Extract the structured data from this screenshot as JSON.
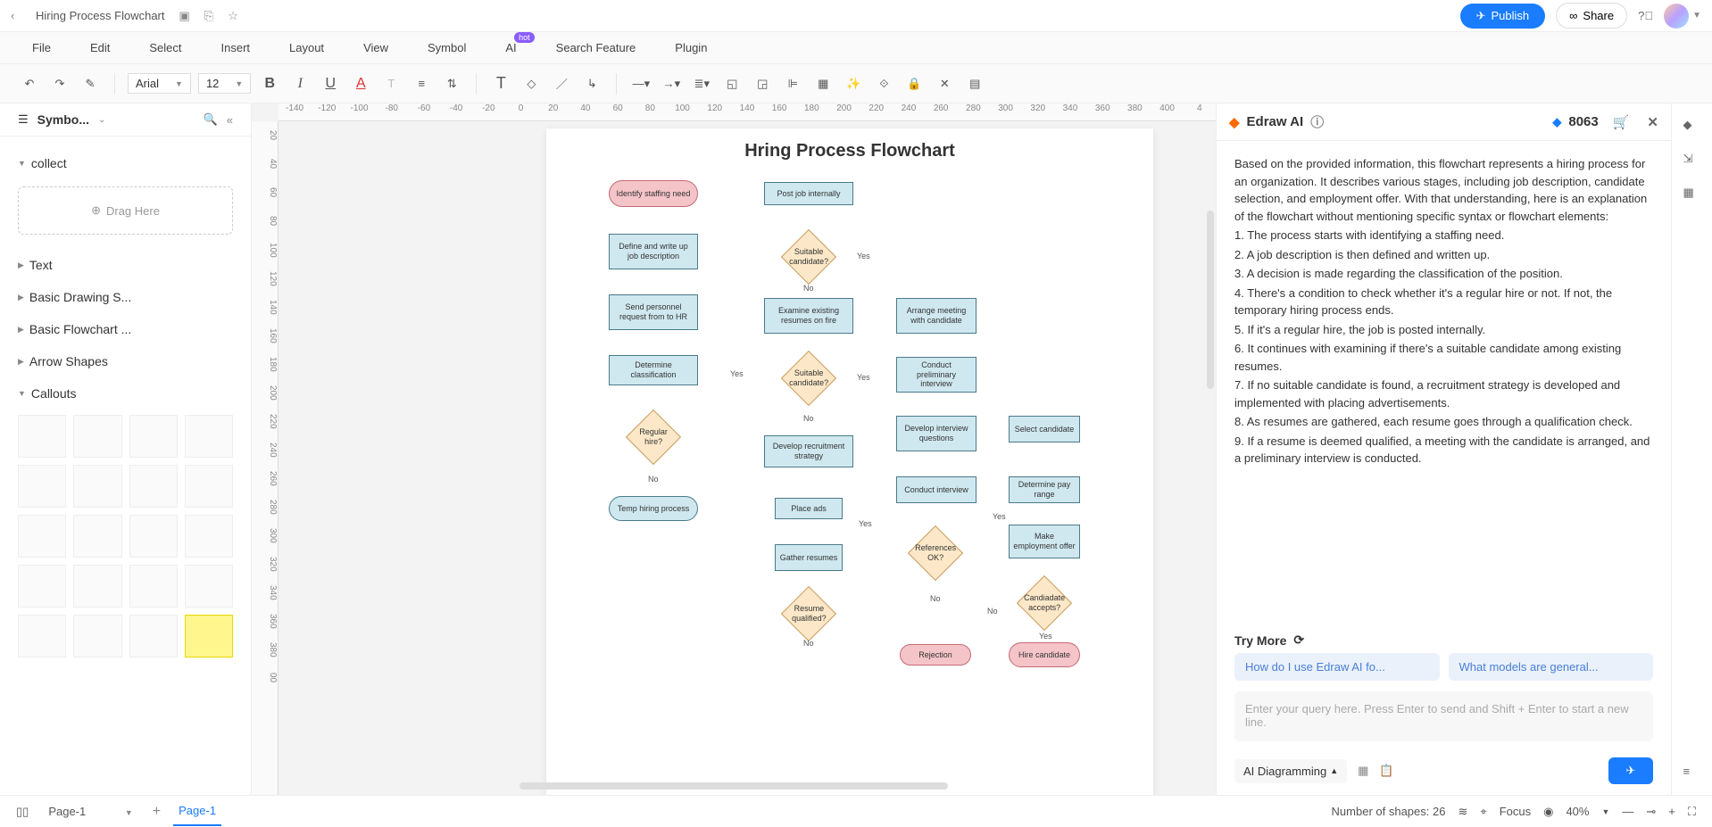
{
  "titlebar": {
    "doc_title": "Hiring Process Flowchart",
    "publish": "Publish",
    "share": "Share"
  },
  "menubar": {
    "items": [
      "File",
      "Edit",
      "Select",
      "Insert",
      "Layout",
      "View",
      "Symbol",
      "AI",
      "Search Feature",
      "Plugin"
    ],
    "hot_badge": "hot"
  },
  "toolbar": {
    "font": "Arial",
    "size": "12"
  },
  "symbol_panel": {
    "title": "Symbo...",
    "drag_here": "Drag Here",
    "categories": {
      "collect": "collect",
      "text": "Text",
      "basic_drawing": "Basic Drawing S...",
      "basic_flowchart": "Basic Flowchart ...",
      "arrow_shapes": "Arrow Shapes",
      "callouts": "Callouts"
    }
  },
  "ruler_h": [
    "-140",
    "-120",
    "-100",
    "-80",
    "-60",
    "-40",
    "-20",
    "0",
    "20",
    "40",
    "60",
    "80",
    "100",
    "120",
    "140",
    "160",
    "180",
    "200",
    "220",
    "240",
    "260",
    "280",
    "300",
    "320",
    "340",
    "360",
    "380",
    "400",
    "4"
  ],
  "ruler_v": [
    "20",
    "40",
    "60",
    "80",
    "100",
    "120",
    "140",
    "160",
    "180",
    "200",
    "220",
    "240",
    "260",
    "280",
    "300",
    "320",
    "340",
    "360",
    "380",
    "00"
  ],
  "flowchart": {
    "title": "Hring Process Flowchart",
    "nodes": {
      "identify": "Identify staffing need",
      "define": "Define and write up job description",
      "send_hr": "Send personnel request from to HR",
      "determine_class": "Determine classification",
      "regular_hire": "Regular hire?",
      "temp_hiring": "Temp hiring process",
      "post_internal": "Post job internally",
      "suitable1": "Suitable candidate?",
      "examine": "Examine existing resumes on fire",
      "suitable2": "Suitable candidate?",
      "dev_recruit": "Develop recruitment strategy",
      "place_ads": "Place ads",
      "gather": "Gather resumes",
      "resume_qual": "Resume qualified?",
      "arrange": "Arrange meeting with candidate",
      "preliminary": "Conduct preliminary interview",
      "dev_questions": "Develop interview questions",
      "conduct_int": "Conduct interview",
      "refs_ok": "References OK?",
      "rejection": "Rejection",
      "select_cand": "Select candidate",
      "pay_range": "Determine pay range",
      "make_offer": "Make employment offer",
      "cand_accepts": "Candiadate accepts?",
      "hire_cand": "Hire candidate"
    },
    "labels": {
      "yes": "Yes",
      "no": "No"
    }
  },
  "ai_panel": {
    "title": "Edraw AI",
    "tokens": "8063",
    "body": [
      "Based on the provided information, this flowchart represents a hiring process for an organization. It describes various stages, including job description, candidate selection, and employment offer. With that understanding, here is an explanation of the flowchart without mentioning specific syntax or flowchart elements:",
      "1. The process starts with identifying a staffing need.",
      "2. A job description is then defined and written up.",
      "3. A decision is made regarding the classification of the position.",
      "4. There's a condition to check whether it's a regular hire or not. If not, the temporary hiring process ends.",
      "5. If it's a regular hire, the job is posted internally.",
      "6. It continues with examining if there's a suitable candidate among existing resumes.",
      "7. If no suitable candidate is found, a recruitment strategy is developed and implemented with placing advertisements.",
      "8. As resumes are gathered, each resume goes through a qualification check.",
      "9. If a resume is deemed qualified, a meeting with the candidate is arranged, and a preliminary interview is conducted."
    ],
    "try_more": "Try More",
    "chips": [
      "How do I use Edraw AI fo...",
      "What models are general..."
    ],
    "input_placeholder": "Enter your query here. Press Enter to send and Shift + Enter to start a new line.",
    "dropdown": "AI Diagramming"
  },
  "statusbar": {
    "page_sel": "Page-1",
    "tab": "Page-1",
    "shapes": "Number of shapes: 26",
    "focus": "Focus",
    "zoom": "40%"
  }
}
